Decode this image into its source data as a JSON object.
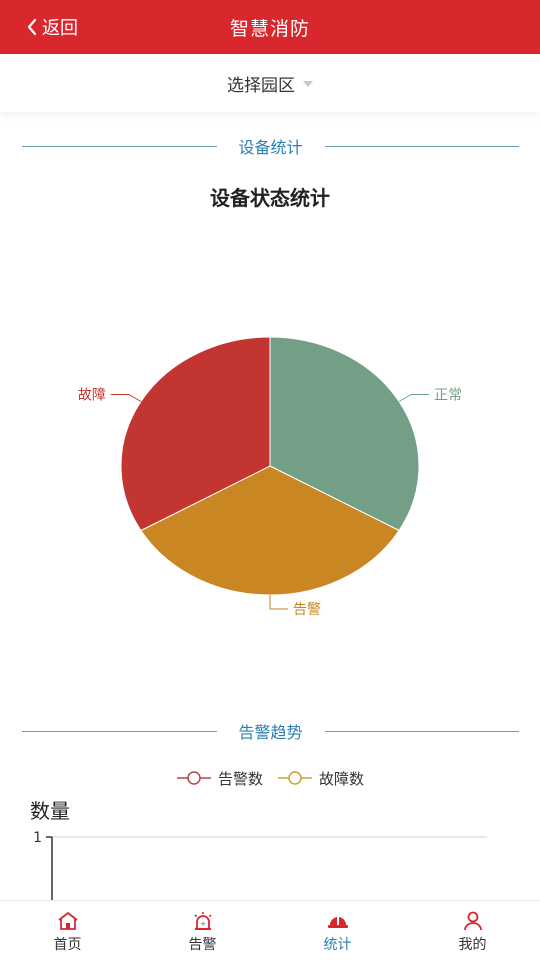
{
  "header": {
    "back_label": "返回",
    "title": "智慧消防",
    "background": "#d9282d"
  },
  "selector": {
    "label": "选择园区"
  },
  "sections": {
    "device_stats": "设备统计",
    "alarm_trend": "告警趋势"
  },
  "chart_data": [
    {
      "type": "pie",
      "title": "设备状态统计",
      "slices": [
        {
          "label": "正常",
          "value": 1,
          "color": "#739f87"
        },
        {
          "label": "告警",
          "value": 1,
          "color": "#ca8622"
        },
        {
          "label": "故障",
          "value": 1,
          "color": "#c23531"
        }
      ]
    },
    {
      "type": "line",
      "title": "",
      "ylabel": "数量",
      "ylim": [
        0,
        1
      ],
      "y_ticks": [
        "1"
      ],
      "legend_position": "top-center",
      "series": [
        {
          "name": "告警数",
          "color": "#b5484b",
          "values": []
        },
        {
          "name": "故障数",
          "color": "#c9a13d",
          "values": []
        }
      ]
    }
  ],
  "nav": {
    "items": [
      {
        "label": "首页",
        "icon": "home-icon",
        "active": false
      },
      {
        "label": "告警",
        "icon": "alarm-light-icon",
        "active": false
      },
      {
        "label": "统计",
        "icon": "helmet-icon",
        "active": true
      },
      {
        "label": "我的",
        "icon": "user-icon",
        "active": false
      }
    ],
    "active_color": "#2b7fb3",
    "icon_color": "#d9282d"
  }
}
